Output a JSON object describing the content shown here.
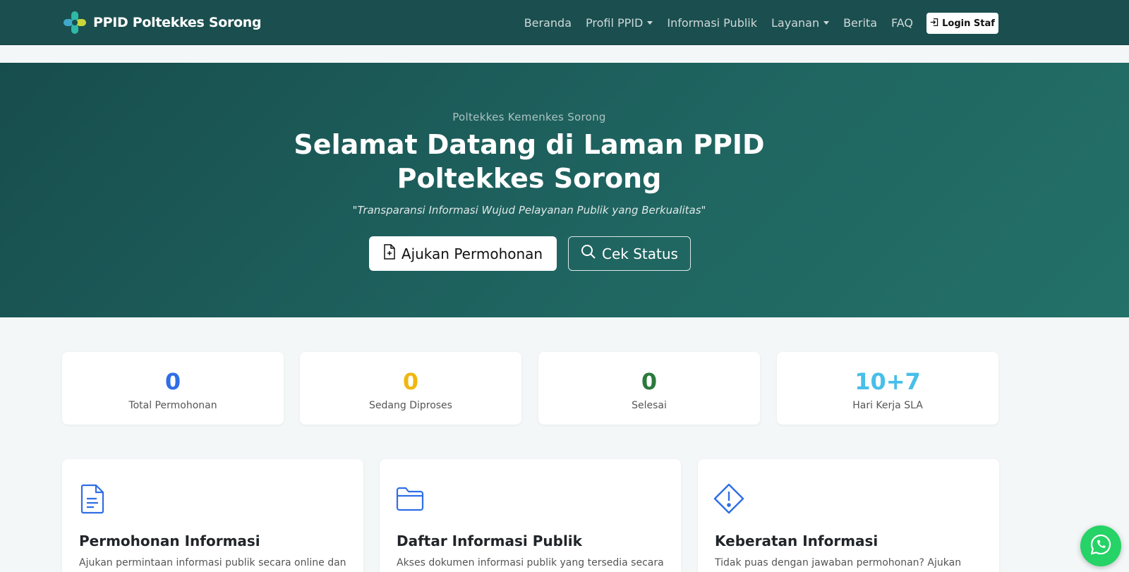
{
  "colors": {
    "navbar": "#1b4e4f",
    "hero_start": "#174d4d",
    "hero_end": "#237168",
    "stat_blue": "#2f6ee5",
    "stat_yellow": "#f0b70f",
    "stat_green": "#2b7a3c",
    "stat_cyan": "#47bfe8",
    "icon_blue": "#2f6ee5",
    "whatsapp": "#25d366"
  },
  "navbar": {
    "brand": "PPID Poltekkes Sorong",
    "items": [
      {
        "label": "Beranda",
        "icon": ""
      },
      {
        "label": "Profil PPID",
        "icon": "caret-down-icon"
      },
      {
        "label": "Informasi Publik",
        "icon": ""
      },
      {
        "label": "Layanan",
        "icon": "caret-down-icon"
      },
      {
        "label": "Berita",
        "icon": ""
      },
      {
        "label": "FAQ",
        "icon": ""
      }
    ],
    "login_label": "Login Staf",
    "login_icon": "login-icon"
  },
  "hero": {
    "subtitle": "Poltekkes Kemenkes Sorong",
    "title_line1": "Selamat Datang di Laman PPID",
    "title_line2": "Poltekkes Sorong",
    "quote": "\"Transparansi Informasi Wujud Pelayanan Publik yang Berkualitas\"",
    "primary_button": "Ajukan Permohonan",
    "primary_icon": "file-plus-icon",
    "secondary_button": "Cek Status",
    "secondary_icon": "search-icon"
  },
  "stats": [
    {
      "value": "0",
      "label": "Total Permohonan",
      "color": "#2f6ee5"
    },
    {
      "value": "0",
      "label": "Sedang Diproses",
      "color": "#f0b70f"
    },
    {
      "value": "0",
      "label": "Selesai",
      "color": "#2b7a3c"
    },
    {
      "value": "10+7",
      "label": "Hari Kerja SLA",
      "color": "#47bfe8"
    }
  ],
  "features": [
    {
      "title": "Permohonan Informasi",
      "desc": "Ajukan permintaan informasi publik secara online dan",
      "icon": "document-icon"
    },
    {
      "title": "Daftar Informasi Publik",
      "desc": "Akses dokumen informasi publik yang tersedia secara",
      "icon": "folder-icon"
    },
    {
      "title": "Keberatan Informasi",
      "desc": "Tidak puas dengan jawaban permohonan? Ajukan",
      "icon": "warning-diamond-icon"
    }
  ],
  "whatsapp_icon": "whatsapp-icon"
}
